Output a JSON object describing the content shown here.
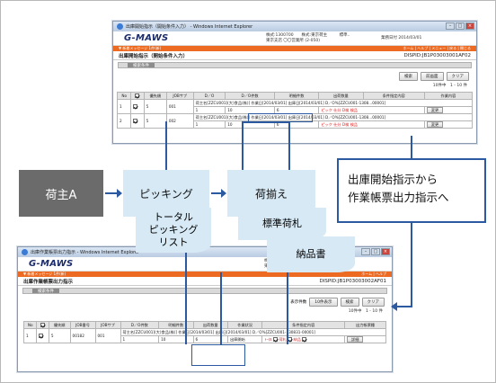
{
  "top_window": {
    "title": "出庫開始指示（開始条件入力） - Windows Internet Explorer",
    "logo": "G-MAWS",
    "header_info": "株式:1300700　　株式:東京荷主　　　標準..\n東京支店 〇〇営業所 (2-050)",
    "header_date": "業務日付 2014/03/01",
    "menu_left": "▼ 新着メッセージ 1件(新)",
    "menu_right": "ホーム | ヘルプ | メニュー | 戻る | 閉じる",
    "page_title": "出庫開始指示（開始条件入力）",
    "dispid": "DISPID:JB1P03003001AF02",
    "cond_label": "",
    "cond_tab": "検索条件",
    "buttons": [
      "検索",
      "前画面",
      "クリア"
    ],
    "count": "10件中　1 - 10 件",
    "columns": [
      "No",
      "",
      "優先順",
      "JOBサブ",
      "D／O",
      "D／O件数",
      "明細件数",
      "出荷数量",
      "条件指定内容",
      "作業内容"
    ],
    "rows": [
      {
        "no": "1",
        "prio": "5",
        "job": "001",
        "cond": "荷主名[ZZCU001](大)食品(株)] 作業日[2014/03/01] 出庫日[2014/03/01] D／O%[ZZCU001-1308...00001]",
        "d1": "1",
        "d2": "10",
        "d3": "6",
        "tags": [
          "ピック",
          "仕分",
          "D検",
          "検品"
        ],
        "btn": "変更"
      },
      {
        "no": "2",
        "prio": "5",
        "job": "002",
        "cond": "荷主名[ZZCU001](大)食品(株)] 作業日[2014/03/01] 出庫日[2014/03/01] D／O%[ZZCU001-1308...00001]",
        "d1": "1",
        "d2": "10",
        "d3": "6",
        "tags": [
          "ピック",
          "仕分",
          "D検",
          "検品"
        ],
        "btn": "変更"
      }
    ]
  },
  "flow": {
    "shipper": "荷主A",
    "picking": "ピッキング",
    "assembly": "荷揃え",
    "total_picking": "トータル\nピッキング\nリスト",
    "standard_tag": "標準荷札",
    "delivery_note": "納品書",
    "callout": "出庫開始指示から\n作業帳票出力指示へ"
  },
  "bottom_window": {
    "title": "出庫作業帳票出力指示 - Windows Internet Explorer",
    "logo": "G-MAWS",
    "header_info": "株式:1300700\n東京支店 〇〇営業所 (2-050)",
    "menu_left": "▼ 新着メッセージ 1件(新)",
    "menu_right": "ホーム | ヘルプ",
    "page_title": "出庫作業帳票出力指示",
    "dispid": "DISPID:JB1P03003002AF01",
    "cond_tab": "検索条件",
    "display_label": "表示件数",
    "display_value": "10件表示",
    "buttons": [
      "検索",
      "クリア"
    ],
    "count": "10件中　1 - 10 件",
    "columns": [
      "No",
      "",
      "優先順",
      "JOB番号",
      "JOBサブ",
      "D／O件数",
      "明細件数",
      "出荷数量",
      "作業状況",
      "条件指定内容",
      "出力帳票種"
    ],
    "row": {
      "no": "1",
      "prio": "5",
      "job": "00182",
      "sub": "001",
      "d1": "1",
      "d2": "10",
      "d3": "6",
      "status": "出庫開始",
      "cond": "荷主名[ZZCU001](大)食品(株)] 作業日[2014/03/01] 出庫日[2014/03/01] D／O%[ZZCU001-130831-00001]",
      "types": [
        "ﾄｰﾀﾙ",
        "荷札",
        "納品"
      ],
      "btn": "詳細"
    }
  }
}
